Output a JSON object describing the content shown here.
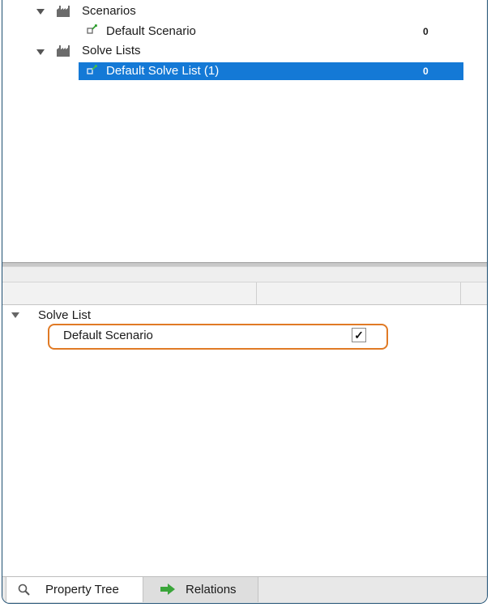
{
  "tree": {
    "groups": [
      {
        "label": "Scenarios",
        "items": [
          {
            "label": "Default Scenario",
            "count": "0",
            "selected": false
          }
        ]
      },
      {
        "label": "Solve Lists",
        "items": [
          {
            "label": "Default Solve List (1)",
            "count": "0",
            "selected": true
          }
        ]
      }
    ]
  },
  "property_panel": {
    "section_label": "Solve List",
    "rows": [
      {
        "label": "Default Scenario",
        "checked": true,
        "check_glyph": "✓"
      }
    ]
  },
  "tabs": [
    {
      "label": "Property Tree",
      "icon": "magnifier-icon",
      "active": true
    },
    {
      "label": "Relations",
      "icon": "green-arrow-icon",
      "active": false
    }
  ],
  "colors": {
    "selection": "#1479d6",
    "highlight_border": "#e07a25",
    "frame_border": "#1e4f72",
    "relations_arrow": "#3aa53a"
  }
}
